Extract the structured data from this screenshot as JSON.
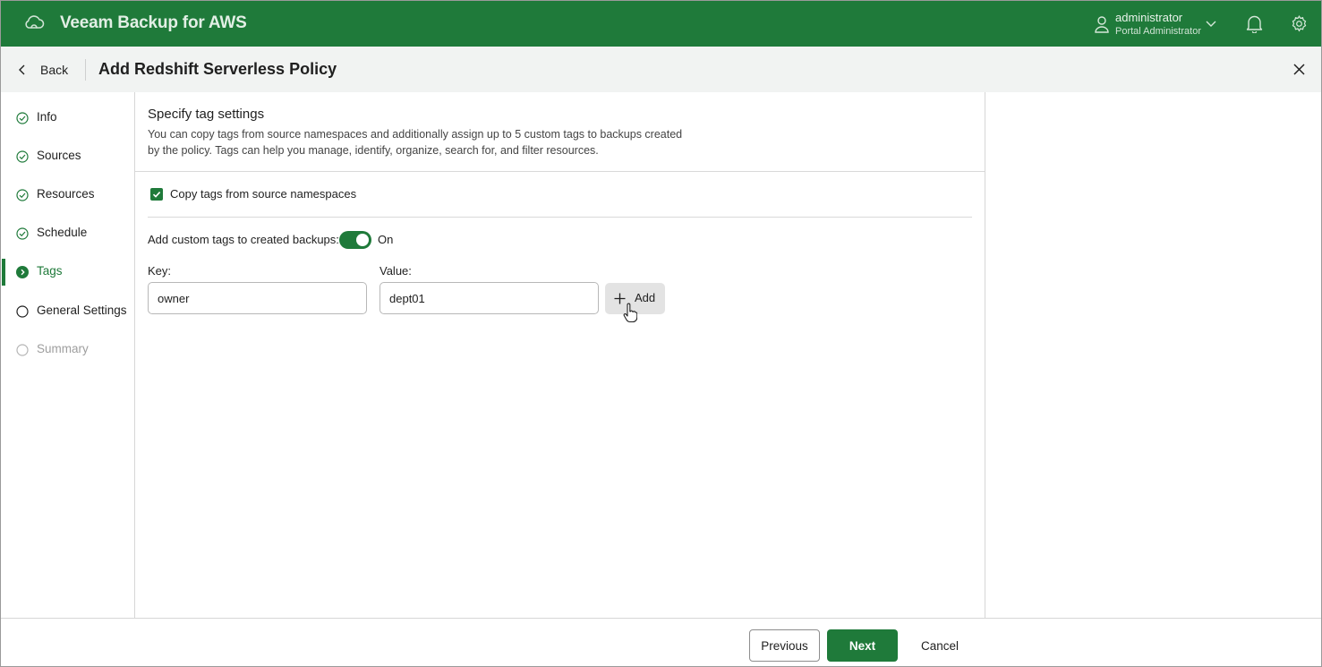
{
  "app": {
    "title": "Veeam Backup for AWS"
  },
  "user": {
    "name": "administrator",
    "role": "Portal Administrator"
  },
  "header": {
    "back_label": "Back",
    "page_title": "Add Redshift Serverless Policy"
  },
  "steps": [
    {
      "label": "Info",
      "state": "completed"
    },
    {
      "label": "Sources",
      "state": "completed"
    },
    {
      "label": "Resources",
      "state": "completed"
    },
    {
      "label": "Schedule",
      "state": "completed"
    },
    {
      "label": "Tags",
      "state": "active"
    },
    {
      "label": "General Settings",
      "state": "pending"
    },
    {
      "label": "Summary",
      "state": "disabled"
    }
  ],
  "content": {
    "section_title": "Specify tag settings",
    "section_description": "You can copy tags from source namespaces and additionally assign up to 5 custom tags to backups created by the policy. Tags can help you manage, identify, organize, search for, and filter resources.",
    "copy_tags": {
      "label": "Copy tags from source namespaces",
      "checked": true
    },
    "custom_tags": {
      "label": "Add custom tags to created backups:",
      "state_label": "On",
      "enabled": true
    },
    "key": {
      "label": "Key:",
      "value": "owner"
    },
    "value": {
      "label": "Value:",
      "value": "dept01"
    },
    "add_label": "Add"
  },
  "footer": {
    "previous_label": "Previous",
    "next_label": "Next",
    "cancel_label": "Cancel"
  },
  "colors": {
    "brand": "#1f7a3a",
    "header_bg": "#f1f3f2"
  }
}
